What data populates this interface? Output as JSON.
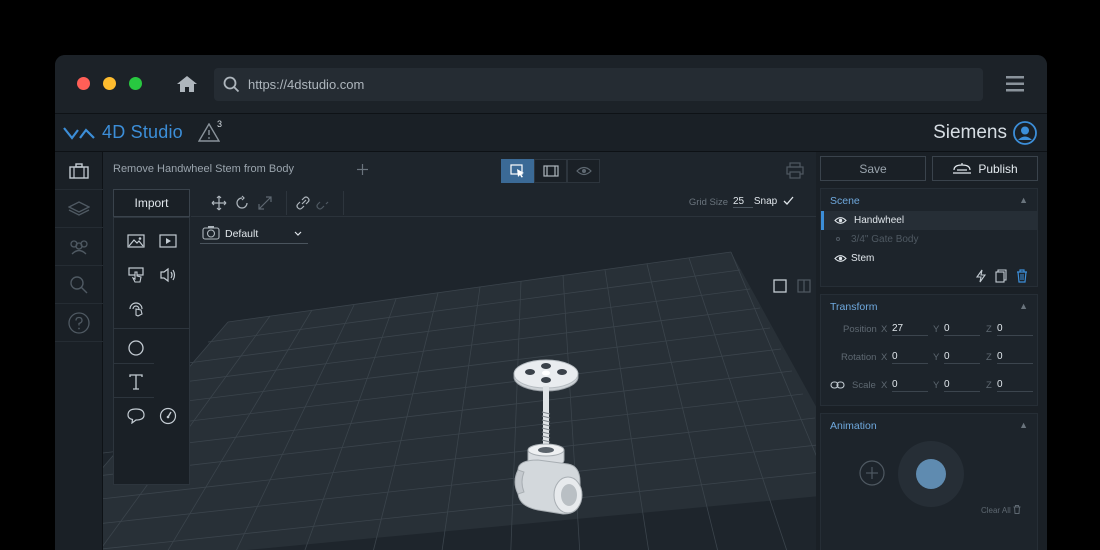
{
  "browser": {
    "url": "https://4dstudio.com",
    "traffic_lights": [
      "#ff5f57",
      "#febc2e",
      "#28c840"
    ]
  },
  "app": {
    "brand": "4D Studio",
    "warning_count": "3",
    "user_name": "Siemens",
    "accent": "#3c8ed8"
  },
  "sidebar": {
    "items": [
      "briefcase-icon",
      "layers-icon",
      "users-icon",
      "search-icon",
      "help-icon"
    ]
  },
  "viewport": {
    "document_title": "Remove Handwheel Stem from Body",
    "import_label": "Import",
    "grid_size_label": "Grid Size",
    "grid_size_value": "25",
    "snap_label": "Snap",
    "camera_select": "Default"
  },
  "panel": {
    "save_label": "Save",
    "publish_label": "Publish",
    "scene": {
      "title": "Scene",
      "items": [
        {
          "label": "Handwheel",
          "visible": true,
          "selected": true
        },
        {
          "label": "3/4\" Gate Body",
          "visible": false,
          "selected": false
        },
        {
          "label": "Stem",
          "visible": true,
          "selected": false
        }
      ]
    },
    "transform": {
      "title": "Transform",
      "position_label": "Position",
      "rotation_label": "Rotation",
      "scale_label": "Scale",
      "position": {
        "x": "27",
        "y": "0",
        "z": "0"
      },
      "rotation": {
        "x": "0",
        "y": "0",
        "z": "0"
      },
      "scale": {
        "x": "0",
        "y": "0",
        "z": "0"
      }
    },
    "animation": {
      "title": "Animation",
      "clear_all": "Clear All"
    }
  }
}
